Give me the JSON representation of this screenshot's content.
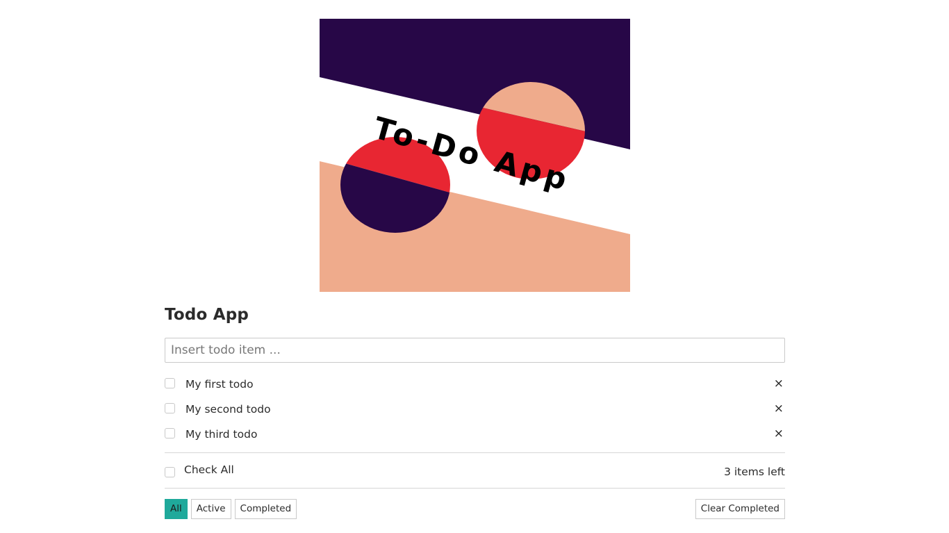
{
  "hero": {
    "text": "To-Do App",
    "colors": {
      "dark": "#270747",
      "peach": "#efab8c",
      "red": "#e82632",
      "white": "#ffffff"
    }
  },
  "app": {
    "title": "Todo App",
    "input": {
      "placeholder": "Insert todo item ...",
      "value": ""
    },
    "todos": [
      {
        "label": "My first todo",
        "done": false,
        "remove": "×"
      },
      {
        "label": "My second todo",
        "done": false,
        "remove": "×"
      },
      {
        "label": "My third todo",
        "done": false,
        "remove": "×"
      }
    ],
    "check_all_label": "Check All",
    "items_left": "3 items left",
    "filters": [
      {
        "label": "All",
        "active": true
      },
      {
        "label": "Active",
        "active": false
      },
      {
        "label": "Completed",
        "active": false
      }
    ],
    "clear_completed_label": "Clear Completed",
    "accent_color": "#1fa99b"
  }
}
